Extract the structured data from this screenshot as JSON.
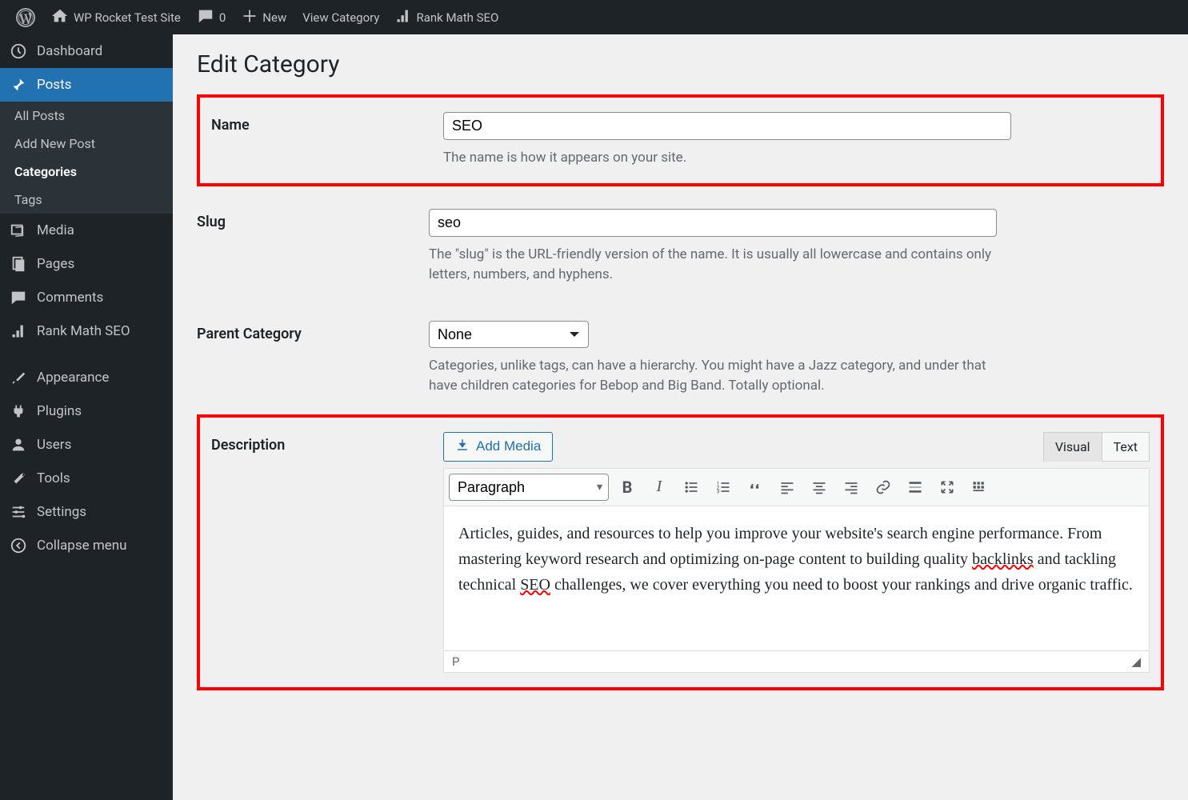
{
  "adminbar": {
    "site_title": "WP Rocket Test Site",
    "comments_count": "0",
    "new_label": "New",
    "view_category": "View Category",
    "rank_math": "Rank Math SEO"
  },
  "sidebar": {
    "dashboard": "Dashboard",
    "posts": "Posts",
    "submenu": {
      "all_posts": "All Posts",
      "add_new": "Add New Post",
      "categories": "Categories",
      "tags": "Tags"
    },
    "media": "Media",
    "pages": "Pages",
    "comments": "Comments",
    "rank_math": "Rank Math SEO",
    "appearance": "Appearance",
    "plugins": "Plugins",
    "users": "Users",
    "tools": "Tools",
    "settings": "Settings",
    "collapse": "Collapse menu"
  },
  "page": {
    "title": "Edit Category",
    "name": {
      "label": "Name",
      "value": "SEO",
      "desc": "The name is how it appears on your site."
    },
    "slug": {
      "label": "Slug",
      "value": "seo",
      "desc": "The \"slug\" is the URL-friendly version of the name. It is usually all lowercase and contains only letters, numbers, and hyphens."
    },
    "parent": {
      "label": "Parent Category",
      "value": "None",
      "desc": "Categories, unlike tags, can have a hierarchy. You might have a Jazz category, and under that have children categories for Bebop and Big Band. Totally optional."
    },
    "description": {
      "label": "Description",
      "add_media": "Add Media",
      "tab_visual": "Visual",
      "tab_text": "Text",
      "format": "Paragraph",
      "content_pre": "Articles, guides, and resources to help you improve your website's search engine performance. From mastering keyword research and optimizing on-page content to building quality ",
      "content_word1": "backlinks",
      "content_mid": " and tackling technical ",
      "content_word2": "SEO",
      "content_post": " challenges, we cover everything you need to boost your rankings and drive organic traffic.",
      "statusbar_path": "P"
    }
  }
}
